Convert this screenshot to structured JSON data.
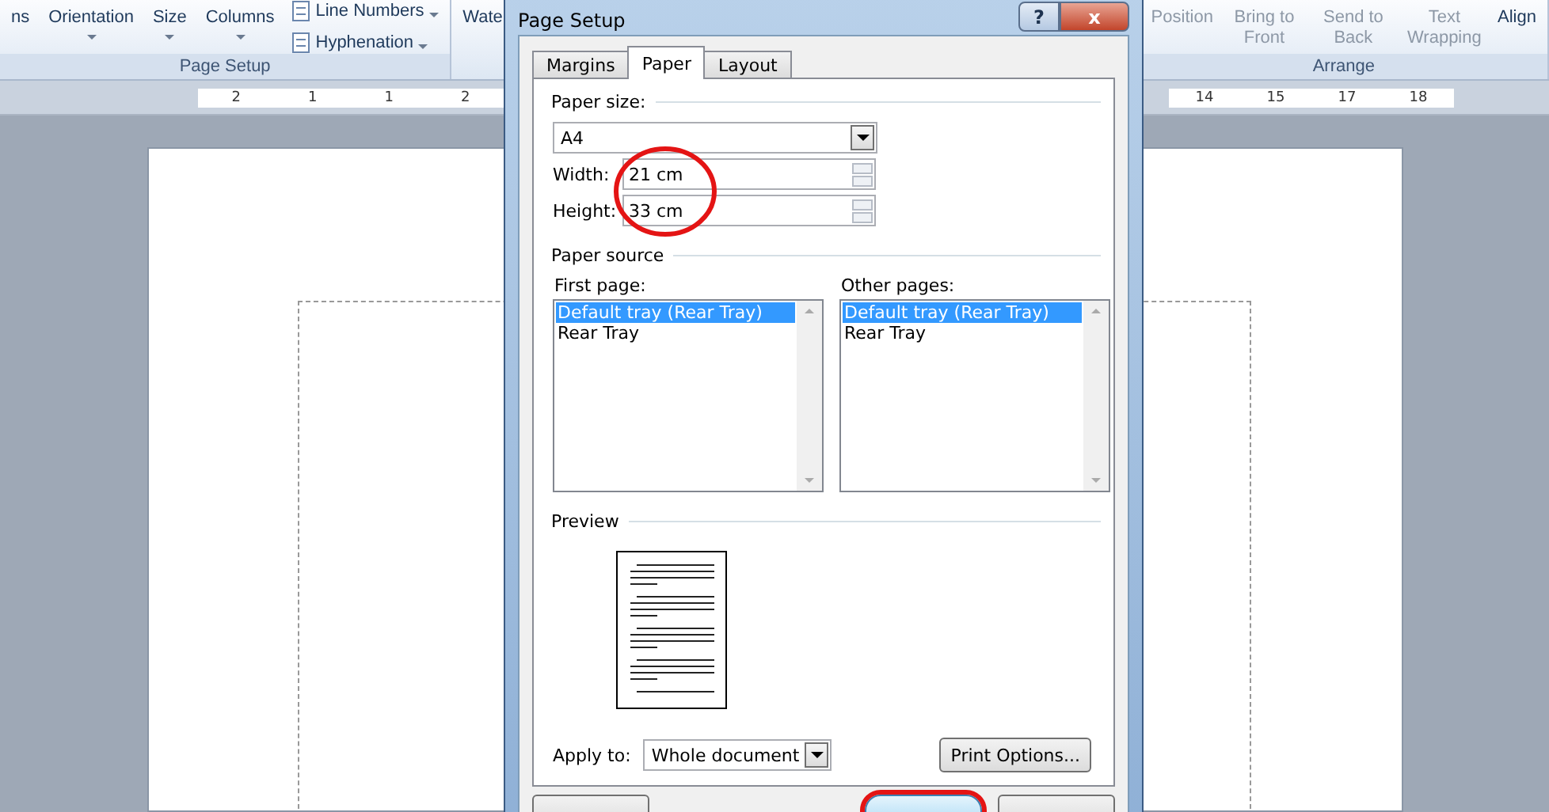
{
  "ribbon": {
    "page_setup": {
      "large_buttons": [
        {
          "label": "ns",
          "has_menu": false
        },
        {
          "label": "Orientation",
          "has_menu": true
        },
        {
          "label": "Size",
          "has_menu": true
        },
        {
          "label": "Columns",
          "has_menu": true
        }
      ],
      "small_buttons": [
        "Line Numbers",
        "Hyphenation"
      ],
      "label": "Page Setup"
    },
    "next_group_cut": "Wate",
    "arrange": {
      "buttons": [
        {
          "label": "Position",
          "disabled": true
        },
        {
          "label": "Bring to Front",
          "disabled": true
        },
        {
          "label": "Send to Back",
          "disabled": true
        },
        {
          "label": "Text Wrapping",
          "disabled": true
        },
        {
          "label": "Align",
          "disabled": false
        }
      ],
      "label": "Arrange"
    }
  },
  "ruler": {
    "left_numbers": [
      "2",
      "1",
      "1",
      "2"
    ],
    "right_numbers": [
      "14",
      "15",
      "17",
      "18"
    ]
  },
  "dialog": {
    "title": "Page Setup",
    "help": "?",
    "close": "x",
    "tabs": [
      {
        "label": "Margins",
        "selected": false
      },
      {
        "label": "Paper",
        "selected": true
      },
      {
        "label": "Layout",
        "selected": false
      }
    ],
    "paper_size": {
      "heading": "Paper size:",
      "value": "A4",
      "width_label": "Width:",
      "width": "21 cm",
      "height_label": "Height:",
      "height": "33 cm"
    },
    "paper_source": {
      "heading": "Paper source",
      "lists": [
        {
          "label": "First page:",
          "items": [
            {
              "text": "Default tray (Rear Tray)",
              "selected": true
            },
            {
              "text": "Rear Tray",
              "selected": false
            }
          ]
        },
        {
          "label": "Other pages:",
          "items": [
            {
              "text": "Default tray (Rear Tray)",
              "selected": true
            },
            {
              "text": "Rear Tray",
              "selected": false
            }
          ]
        }
      ]
    },
    "preview": {
      "heading": "Preview"
    },
    "apply_to": {
      "label": "Apply to:",
      "value": "Whole document"
    },
    "print_options": "Print Options...",
    "annotations": [
      {
        "kind": "circle"
      },
      {
        "kind": "circle"
      }
    ]
  }
}
